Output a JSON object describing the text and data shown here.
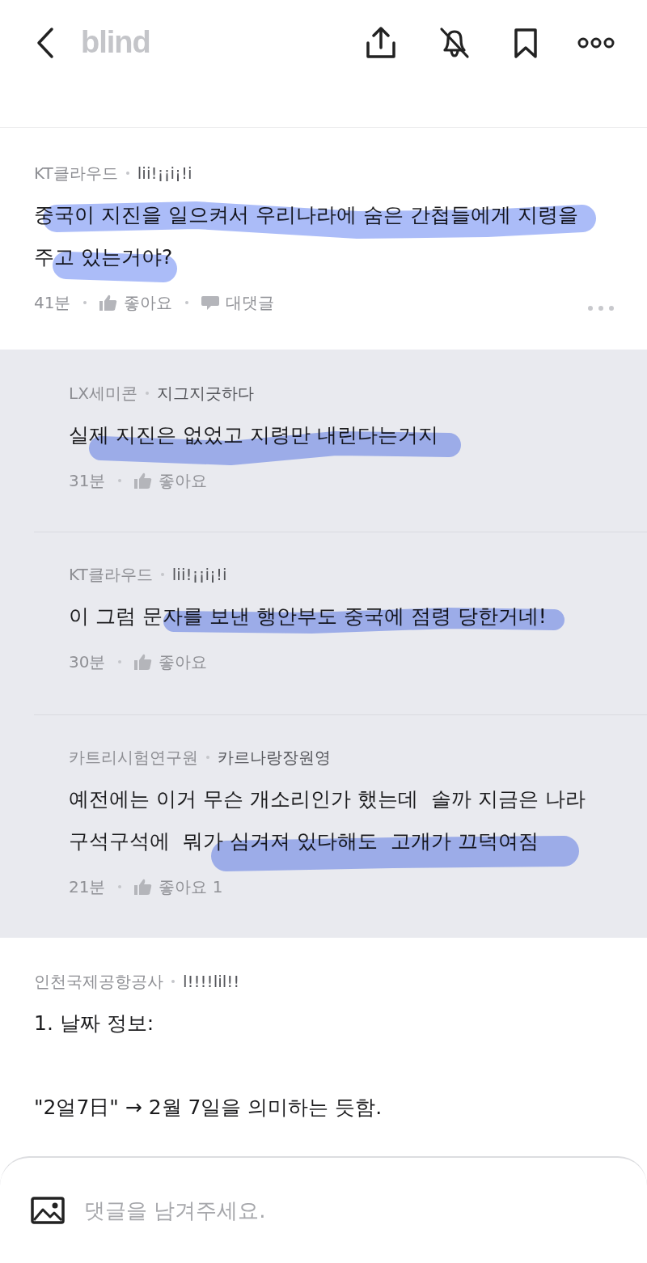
{
  "header": {
    "logo": "blind"
  },
  "comments": [
    {
      "company": "KT클라우드",
      "nickname": "lii!¡¡i¡!i",
      "body": "중국이 지진을 일으켜서 우리나라에 숨은 간첩들에게 지령을 주고 있는거야?",
      "time": "41분",
      "like": "좋아요",
      "reply": "대댓글",
      "highlighted": true,
      "replies": [
        {
          "company": "LX세미콘",
          "nickname": "지그지긋하다",
          "body": "실제 지진은 없었고 지령만 내린다는거지",
          "time": "31분",
          "like": "좋아요",
          "highlighted": true
        },
        {
          "company": "KT클라우드",
          "nickname": "lii!¡¡i¡!i",
          "body": "이 그럼 문자를 보낸 행안부도 중국에 점령 당한거네!",
          "time": "30분",
          "like": "좋아요",
          "highlighted": true
        },
        {
          "company": "카트리시험연구원",
          "nickname": "카르나랑장원영",
          "body": "예전에는 이거 무슨 개소리인가 했는데  솔까 지금은 나라 구석구석에  뭐가 심겨져 있다해도  고개가 끄덕여짐",
          "time": "21분",
          "like": "좋아요 1",
          "highlighted": true
        }
      ]
    },
    {
      "company": "인천국제공항공사",
      "nickname": "l!!!!lil!!",
      "lines": [
        "1. 날짜 정보:",
        "\"2얼7日\" → 2월 7일을 의미하는 듯함."
      ]
    }
  ],
  "composer": {
    "placeholder": "댓글을 남겨주세요."
  }
}
